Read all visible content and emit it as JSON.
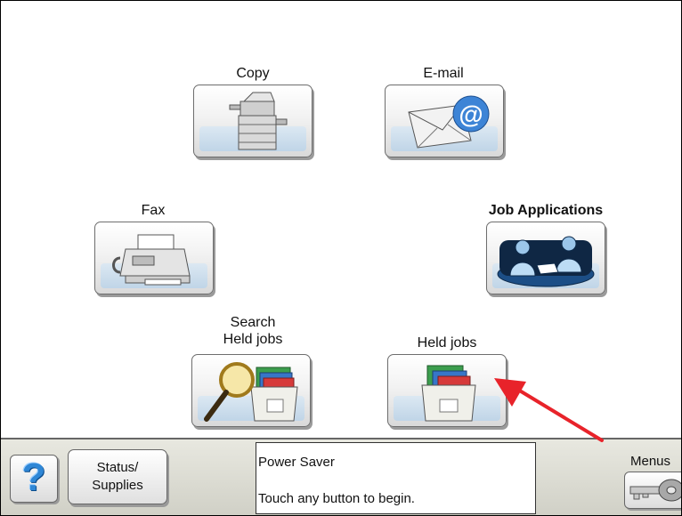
{
  "tiles": {
    "copy": {
      "label": "Copy",
      "icon": "copier-icon"
    },
    "email": {
      "label": "E-mail",
      "icon": "email-envelope-icon"
    },
    "fax": {
      "label": "Fax",
      "icon": "fax-machine-icon"
    },
    "job_applications": {
      "label": "Job Applications",
      "icon": "meeting-people-icon"
    },
    "search_held_jobs": {
      "label_line1": "Search",
      "label_line2": "Held jobs",
      "icon": "magnifier-folders-icon"
    },
    "held_jobs": {
      "label": "Held jobs",
      "icon": "folders-box-icon"
    }
  },
  "bottom_bar": {
    "help_label": "?",
    "status_line1": "Status/",
    "status_line2": "Supplies",
    "message_line1": "Power Saver",
    "message_line2": "Touch any button to begin.",
    "menus_label": "Menus"
  },
  "colors": {
    "button_face": "#ececec",
    "help_icon": "#2f87d6",
    "annotation_arrow": "#e8232a",
    "bottom_bar": "#dcdcd2"
  }
}
